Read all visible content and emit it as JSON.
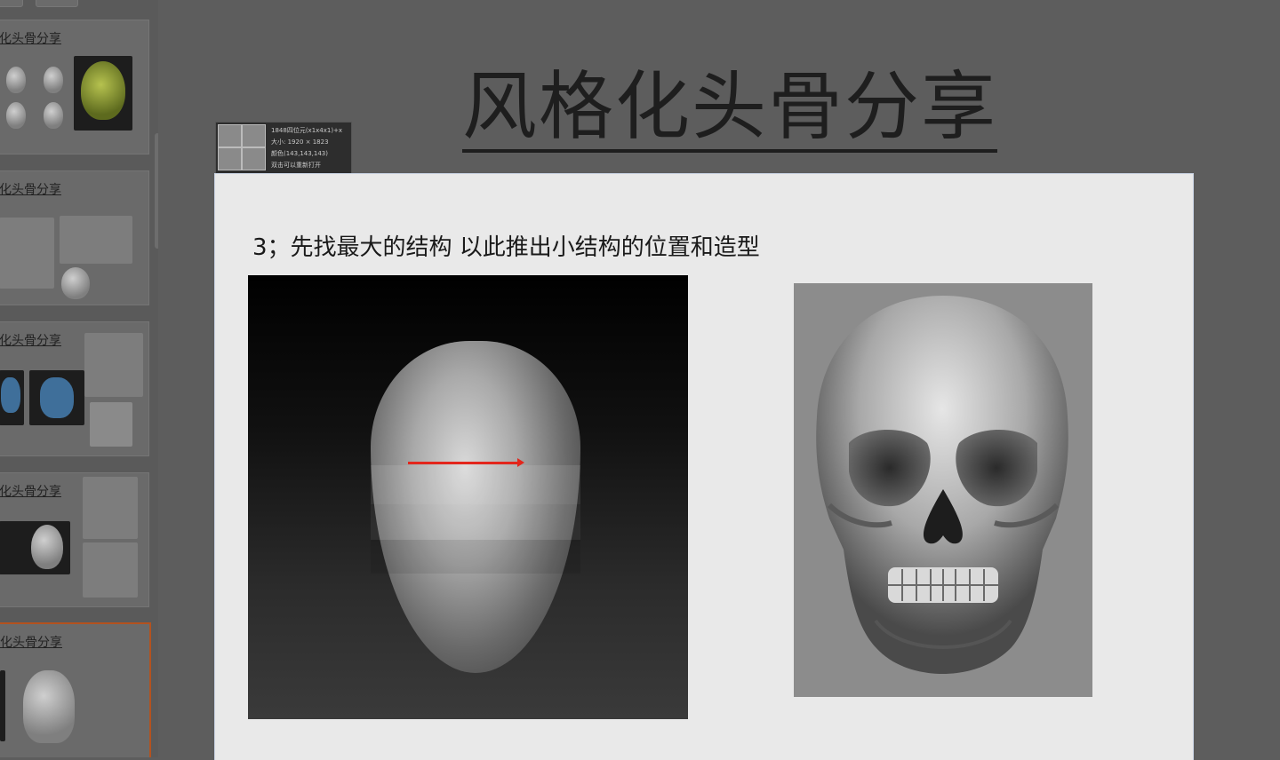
{
  "slide": {
    "title": "风格化头骨分享",
    "subtitle": "3；先找最大的结构   以此推出小结构的位置和造型"
  },
  "thumbnails": [
    {
      "title": "化头骨分享",
      "active": false
    },
    {
      "title": "化头骨分享",
      "active": false
    },
    {
      "title": "化头骨分享",
      "active": false
    },
    {
      "title": "化头骨分享",
      "active": false
    },
    {
      "title": "化头骨分享",
      "active": true
    }
  ],
  "tooltip": {
    "lines": [
      "1848四位元(x1x4x1)+x",
      "大小: 1920 × 1823",
      "颜色(143,143,143)",
      "双击可以重新打开"
    ]
  },
  "colors": {
    "accent_arrow": "#e3261c",
    "active_thumb_border": "#b3521f"
  },
  "icons": {
    "direction_arrow": "red-arrow-icon"
  }
}
